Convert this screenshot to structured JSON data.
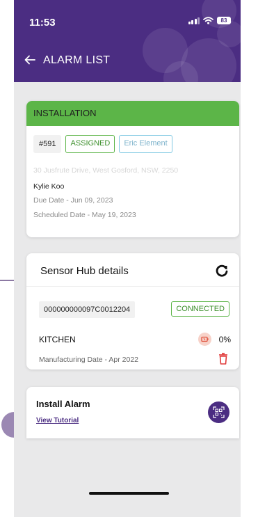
{
  "status_bar": {
    "time": "11:53",
    "battery": "83",
    "icons": [
      "signal-icon",
      "wifi-icon",
      "battery-icon"
    ]
  },
  "header": {
    "title": "ALARM LIST",
    "back_icon": "arrow-left-icon",
    "color": "#4b2d82"
  },
  "installation": {
    "heading": "INSTALLATION",
    "job_id": "#591",
    "status": "ASSIGNED",
    "technician": "Eric Element",
    "address": "30 Jusfrute Drive, West Gosford, NSW, 2250",
    "customer": "Kylie Koo",
    "due_date": "Due Date - Jun 09, 2023",
    "scheduled_date": "Scheduled Date - May 19, 2023",
    "accent": "#5cb548"
  },
  "sensor_hub": {
    "title": "Sensor Hub details",
    "serial": "000000000097C0012204",
    "connection": "CONNECTED",
    "room": "KITCHEN",
    "battery_pct": "0%",
    "manufacturing_date": "Manufacturing Date - Apr 2022",
    "icons": [
      "refresh-icon",
      "battery-icon",
      "trash-icon"
    ]
  },
  "install_alarm": {
    "title": "Install Alarm",
    "link": "View Tutorial",
    "icon": "qr-scan-icon"
  }
}
